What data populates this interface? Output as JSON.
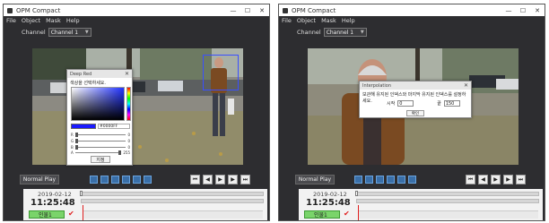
{
  "left_window": {
    "title": "OPM Compact",
    "menu": [
      "File",
      "Object",
      "Mask",
      "Help"
    ],
    "channel_label": "Channel",
    "channel_value": "Channel 1",
    "normal_play_label": "Normal Play",
    "timeline": {
      "date": "2019-02-12",
      "time": "11:25:48",
      "camera_label": "인물1"
    },
    "color_dialog": {
      "title": "Deep Red",
      "prompt": "색상을 선택하세요.",
      "hex_value": "#0000FF",
      "ok_label": "지정",
      "slider_values": [
        "0",
        "0",
        "0",
        "255"
      ]
    }
  },
  "right_window": {
    "title": "OPM Compact",
    "menu": [
      "File",
      "Object",
      "Mask",
      "Help"
    ],
    "channel_label": "Channel",
    "channel_value": "Channel 1",
    "normal_play_label": "Normal Play",
    "timeline": {
      "date": "2019-02-12",
      "time": "11:25:48",
      "camera_label": "인물1"
    },
    "interpolation_dialog": {
      "title": "Interpolation",
      "prompt": "보관해 유지된 인덱스와 마지막 유지된 인덱스를 설정하세요.",
      "start_label": "시작",
      "start_value": "0",
      "end_label": "끝",
      "end_value": "150",
      "ok_label": "확인"
    }
  },
  "colors": {
    "window_bg": "#2d2d30",
    "roi_box": "#3a4fff",
    "cursor": "#e02020",
    "camera_tag": "#7ad46a"
  }
}
